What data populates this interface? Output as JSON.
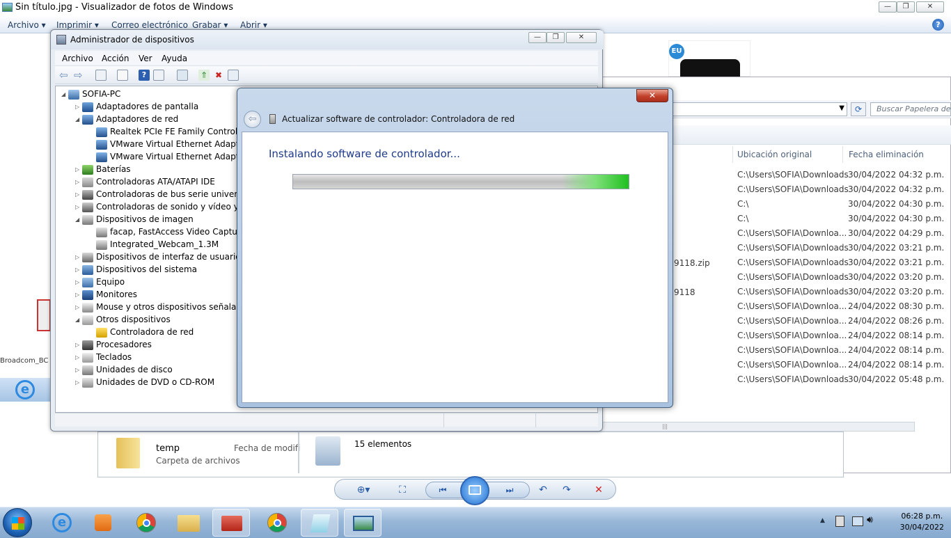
{
  "photo_viewer": {
    "title": "Sin título.jpg - Visualizador de fotos de Windows",
    "menu": [
      "Archivo",
      "Imprimir",
      "Correo electrónico",
      "Grabar",
      "Abrir"
    ]
  },
  "left_strip": {
    "label": "Broadcom_BC"
  },
  "product_badge": "EU",
  "recycle_bin": {
    "search_placeholder": "Buscar Papelera de r",
    "columns": [
      "Ubicación original",
      "Fecha eliminación"
    ],
    "name_fragments": [
      "9118.zip",
      "9118"
    ],
    "rows": [
      {
        "location": "C:\\Users\\SOFIA\\Downloads",
        "date": "30/04/2022 04:32 p.m."
      },
      {
        "location": "C:\\Users\\SOFIA\\Downloads",
        "date": "30/04/2022 04:32 p.m."
      },
      {
        "location": "C:\\",
        "date": "30/04/2022 04:30 p.m."
      },
      {
        "location": "C:\\",
        "date": "30/04/2022 04:30 p.m."
      },
      {
        "location": "C:\\Users\\SOFIA\\Downloa...",
        "date": "30/04/2022 04:29 p.m."
      },
      {
        "location": "C:\\Users\\SOFIA\\Downloads",
        "date": "30/04/2022 03:21 p.m."
      },
      {
        "location": "C:\\Users\\SOFIA\\Downloads",
        "date": "30/04/2022 03:21 p.m."
      },
      {
        "location": "C:\\Users\\SOFIA\\Downloads",
        "date": "30/04/2022 03:20 p.m."
      },
      {
        "location": "C:\\Users\\SOFIA\\Downloads",
        "date": "30/04/2022 03:20 p.m."
      },
      {
        "location": "C:\\Users\\SOFIA\\Downloa...",
        "date": "24/04/2022 08:30 p.m."
      },
      {
        "location": "C:\\Users\\SOFIA\\Downloa...",
        "date": "24/04/2022 08:26 p.m."
      },
      {
        "location": "C:\\Users\\SOFIA\\Downloa...",
        "date": "24/04/2022 08:14 p.m."
      },
      {
        "location": "C:\\Users\\SOFIA\\Downloa...",
        "date": "24/04/2022 08:14 p.m."
      },
      {
        "location": "C:\\Users\\SOFIA\\Downloa...",
        "date": "24/04/2022 08:14 p.m."
      },
      {
        "location": "C:\\Users\\SOFIA\\Downloads",
        "date": "30/04/2022 05:48 p.m."
      }
    ],
    "count": "15 elementos"
  },
  "folder_panel": {
    "name": "temp",
    "type": "Carpeta de archivos",
    "date_label": "Fecha de modifi"
  },
  "device_manager": {
    "title": "Administrador de dispositivos",
    "menu": [
      "Archivo",
      "Acción",
      "Ver",
      "Ayuda"
    ],
    "tree": [
      {
        "text": "SOFIA-PC",
        "level": 0,
        "expander": "open",
        "icon": "computer-icon"
      },
      {
        "text": "Adaptadores de pantalla",
        "level": 1,
        "expander": "closed",
        "icon": "display-adapter-icon"
      },
      {
        "text": "Adaptadores de red",
        "level": 1,
        "expander": "open",
        "icon": "network-adapter-icon"
      },
      {
        "text": "Realtek PCIe FE Family Controller",
        "level": 2,
        "expander": "",
        "icon": "network-adapter-icon"
      },
      {
        "text": "VMware Virtual Ethernet Adapter f",
        "level": 2,
        "expander": "",
        "icon": "network-adapter-icon"
      },
      {
        "text": "VMware Virtual Ethernet Adapter f",
        "level": 2,
        "expander": "",
        "icon": "network-adapter-icon"
      },
      {
        "text": "Baterías",
        "level": 1,
        "expander": "closed",
        "icon": "battery-icon"
      },
      {
        "text": "Controladoras ATA/ATAPI IDE",
        "level": 1,
        "expander": "closed",
        "icon": "ide-controller-icon"
      },
      {
        "text": "Controladoras de bus serie universal",
        "level": 1,
        "expander": "closed",
        "icon": "usb-icon"
      },
      {
        "text": "Controladoras de sonido y vídeo y dis",
        "level": 1,
        "expander": "closed",
        "icon": "speaker-icon"
      },
      {
        "text": "Dispositivos de imagen",
        "level": 1,
        "expander": "open",
        "icon": "camera-icon"
      },
      {
        "text": "facap, FastAccess Video Capture",
        "level": 2,
        "expander": "",
        "icon": "camera-icon"
      },
      {
        "text": "Integrated_Webcam_1.3M",
        "level": 2,
        "expander": "",
        "icon": "camera-icon"
      },
      {
        "text": "Dispositivos de interfaz de usuario (HI",
        "level": 1,
        "expander": "closed",
        "icon": "hid-icon"
      },
      {
        "text": "Dispositivos del sistema",
        "level": 1,
        "expander": "closed",
        "icon": "system-device-icon"
      },
      {
        "text": "Equipo",
        "level": 1,
        "expander": "closed",
        "icon": "computer-icon"
      },
      {
        "text": "Monitores",
        "level": 1,
        "expander": "closed",
        "icon": "monitor-icon"
      },
      {
        "text": "Mouse y otros dispositivos señaladore",
        "level": 1,
        "expander": "closed",
        "icon": "mouse-icon"
      },
      {
        "text": "Otros dispositivos",
        "level": 1,
        "expander": "open",
        "icon": "unknown-device-icon"
      },
      {
        "text": "Controladora de red",
        "level": 2,
        "expander": "",
        "icon": "warning-device-icon"
      },
      {
        "text": "Procesadores",
        "level": 1,
        "expander": "closed",
        "icon": "processor-icon"
      },
      {
        "text": "Teclados",
        "level": 1,
        "expander": "closed",
        "icon": "keyboard-icon"
      },
      {
        "text": "Unidades de disco",
        "level": 1,
        "expander": "closed",
        "icon": "disk-icon"
      },
      {
        "text": "Unidades de DVD o CD-ROM",
        "level": 1,
        "expander": "closed",
        "icon": "dvd-icon"
      }
    ]
  },
  "wizard": {
    "title": "Actualizar software de controlador: Controladora de red",
    "heading": "Instalando software de controlador...",
    "progress": 1.0
  },
  "taskbar": {
    "time": "06:28 p.m.",
    "date": "30/04/2022"
  },
  "colors": {
    "wizard_heading": "#1e3a8a",
    "progress_green": "#20c020",
    "close_red": "#c3402a"
  }
}
